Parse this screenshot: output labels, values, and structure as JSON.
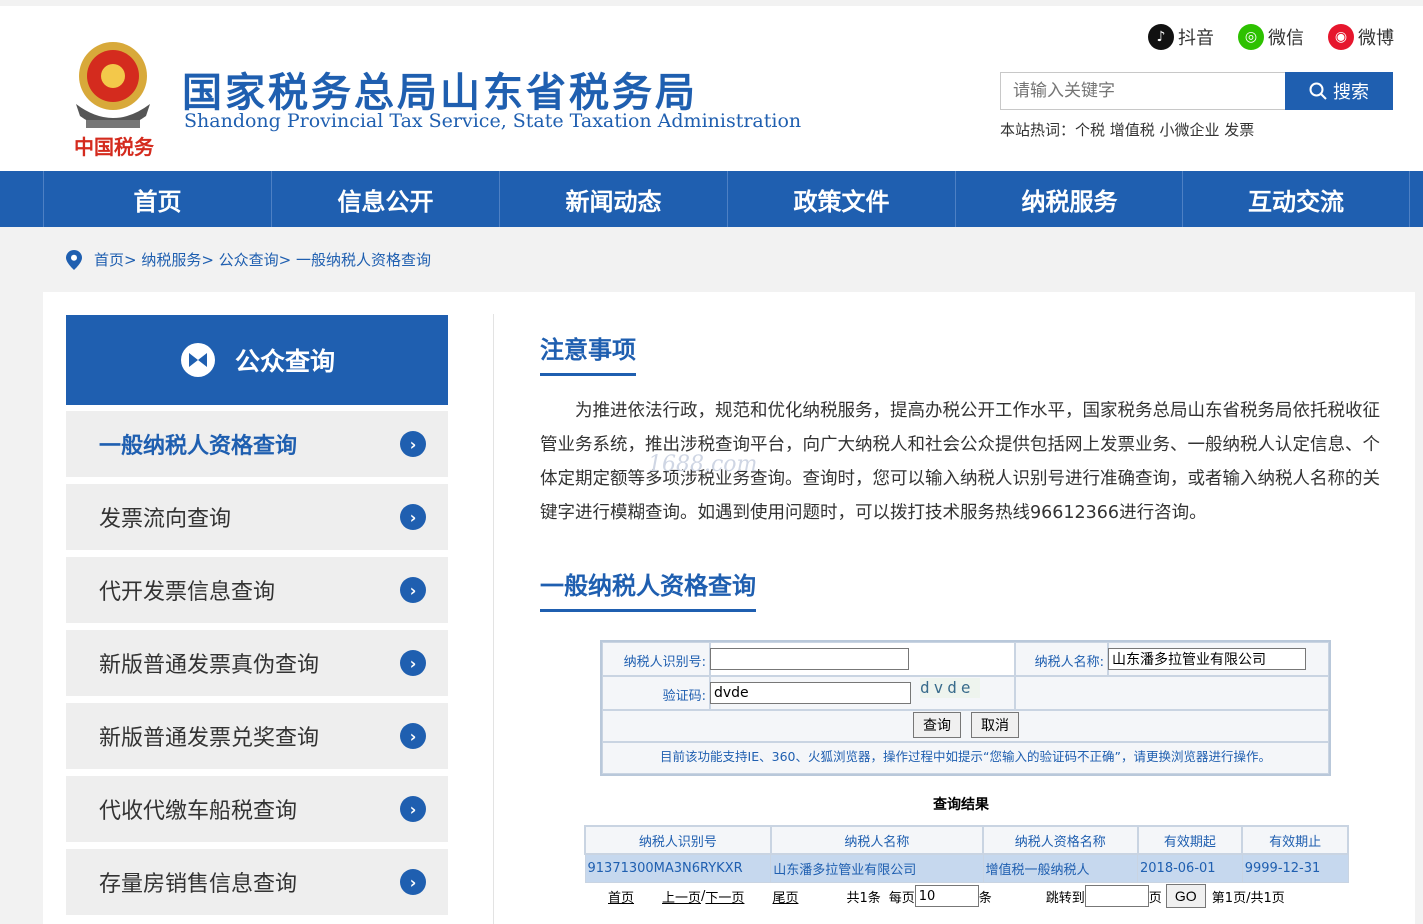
{
  "header": {
    "title": "国家税务总局山东省税务局",
    "subtitle": "Shandong Provincial Tax Service, State Taxation Administration",
    "emblem_text": "中国税务",
    "social": [
      {
        "label": "抖音",
        "icon": "douyin-icon",
        "color": "#111111"
      },
      {
        "label": "微信",
        "icon": "wechat-icon",
        "color": "#2dc100"
      },
      {
        "label": "微博",
        "icon": "weibo-icon",
        "color": "#e6162d"
      }
    ],
    "search": {
      "placeholder": "请输入关键字",
      "button": "搜索"
    },
    "hotwords": "本站热词：个税 增值税 小微企业 发票"
  },
  "nav": [
    "首页",
    "信息公开",
    "新闻动态",
    "政策文件",
    "纳税服务",
    "互动交流"
  ],
  "breadcrumb": "首页> 纳税服务> 公众查询> 一般纳税人资格查询",
  "sidebar": {
    "title": "公众查询",
    "items": [
      {
        "label": "一般纳税人资格查询",
        "active": true
      },
      {
        "label": "发票流向查询"
      },
      {
        "label": "代开发票信息查询"
      },
      {
        "label": "新版普通发票真伪查询"
      },
      {
        "label": "新版普通发票兑奖查询"
      },
      {
        "label": "代收代缴车船税查询"
      },
      {
        "label": "存量房销售信息查询"
      }
    ]
  },
  "notice": {
    "title": "注意事项",
    "body": "为推进依法行政，规范和优化纳税服务，提高办税公开工作水平，国家税务总局山东省税务局依托税收征管业务系统，推出涉税查询平台，向广大纳税人和社会公众提供包括网上发票业务、一般纳税人认定信息、个体定期定额等多项涉税业务查询。查询时，您可以输入纳税人识别号进行准确查询，或者输入纳税人名称的关键字进行模糊查询。如遇到使用问题时，可以拨打技术服务热线96612366进行咨询。",
    "watermark": "1688.com"
  },
  "query": {
    "title": "一般纳税人资格查询",
    "id_label": "纳税人识别号:",
    "id_value": "",
    "name_label": "纳税人名称:",
    "name_value": "山东潘多拉管业有限公司",
    "captcha_label": "验证码:",
    "captcha_value": "dvde",
    "captcha_image": "dvde",
    "submit": "查询",
    "cancel": "取消",
    "hint": "目前该功能支持IE、360、火狐浏览器，操作过程中如提示“您输入的验证码不正确”，请更换浏览器进行操作。"
  },
  "results": {
    "title": "查询结果",
    "columns": [
      "纳税人识别号",
      "纳税人名称",
      "纳税人资格名称",
      "有效期起",
      "有效期止"
    ],
    "rows": [
      [
        "91371300MA3N6RYKXR",
        "山东潘多拉管业有限公司",
        "增值税一般纳税人",
        "2018-06-01",
        "9999-12-31"
      ]
    ]
  },
  "pager": {
    "first": "首页",
    "prev": "上一页",
    "sep": "/",
    "next": "下一页",
    "last": "尾页",
    "total": "共1条",
    "per_page_label": "每页",
    "per_page": "10",
    "per_page_unit": "条",
    "jump_label": "跳转到",
    "jump_value": "",
    "jump_unit": "页",
    "go": "GO",
    "status": "第1页/共1页"
  }
}
